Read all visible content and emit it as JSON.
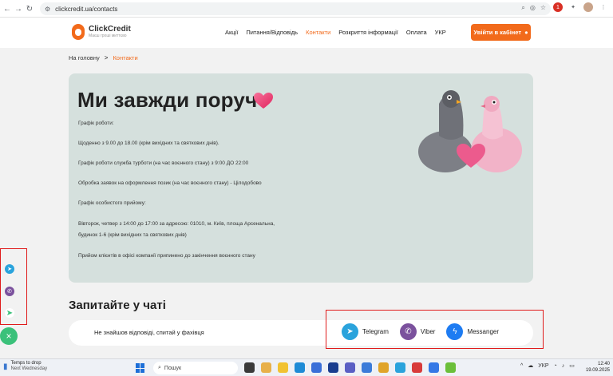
{
  "browser": {
    "url": "clickcredit.ua/contacts",
    "profile_badge": "1"
  },
  "site": {
    "logo_name": "ClickCredit",
    "logo_tagline": "Маєш гроші миттєво",
    "menu": [
      {
        "label": "Акції"
      },
      {
        "label": "Питання/Відповідь"
      },
      {
        "label": "Контакти",
        "active": true
      },
      {
        "label": "Розкриття інформації"
      },
      {
        "label": "Оплата"
      },
      {
        "label": "УКР"
      }
    ],
    "login_button": "Увійти в кабінет",
    "accent_color": "#f26a1b"
  },
  "breadcrumb": {
    "home": "На головну",
    "separator": ">",
    "current": "Контакти"
  },
  "contacts": {
    "title": "Ми завжди поруч",
    "lines": [
      "Графік роботи:",
      "Щоденно з 9.00 до 18.00 (крім вихідних та святкових днів).",
      "Графік роботи служба турботи (на час воєнного стану) з 9:00 ДО 22:00",
      "Обробка заявок на оформлення позик (на час воєнного стану) - Цілодобово",
      "Графік особистого прийому:",
      "Вівторок, четвер з 14:00 до 17:00 за адресою: 01010, м. Київ, площа Арсенальна,",
      "будинок 1-6 (крім вихідних та святкових днів)",
      "Прийом клієнтів в офісі компанії припинено до закінчення воєнного стану"
    ]
  },
  "chat": {
    "title": "Запитайте у чаті",
    "ask_text": "Не знайшов відповіді, спитай у фахівця",
    "channels": [
      {
        "label": "Telegram",
        "icon": "telegram-icon",
        "color": "#2aa3dc"
      },
      {
        "label": "Viber",
        "icon": "viber-icon",
        "color": "#7b519d"
      },
      {
        "label": "Messanger",
        "icon": "messenger-icon",
        "color": "#1e7cf2"
      }
    ]
  },
  "floating_widget": {
    "icons": [
      "telegram-icon",
      "viber-icon",
      "send-icon"
    ],
    "close_icon": "close-icon"
  },
  "taskbar": {
    "weather_title": "Temps to drop",
    "weather_sub": "Next Wednesday",
    "search_placeholder": "Пошук",
    "language": "УКР",
    "time": "12:40",
    "date": "19.09.2025"
  }
}
